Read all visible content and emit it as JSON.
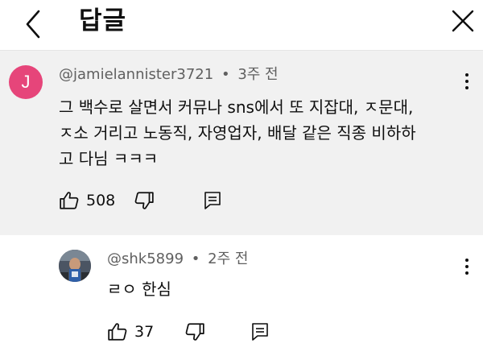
{
  "header": {
    "title": "답글"
  },
  "parent_comment": {
    "avatar_letter": "J",
    "avatar_color": "#e6457a",
    "author": "@jamielannister3721",
    "separator": "•",
    "time": "3주 전",
    "lines": [
      "그 백수로 살면서 커뮤나 sns에서 또 지잡대, ㅈ문대,",
      "ㅈ소 거리고 노동직, 자영업자, 배달 같은 직종 비하하",
      "고 다님 ㅋㅋㅋ"
    ],
    "like_count": "508"
  },
  "reply": {
    "author": "@shk5899",
    "separator": "•",
    "time": "2주 전",
    "text": "ㄹㅇ 한심",
    "like_count": "37"
  },
  "icons": {
    "back": "chevron-left-icon",
    "close": "close-icon",
    "more": "more-vertical-icon",
    "like": "thumbs-up-icon",
    "dislike": "thumbs-down-icon",
    "reply": "reply-comment-icon"
  }
}
